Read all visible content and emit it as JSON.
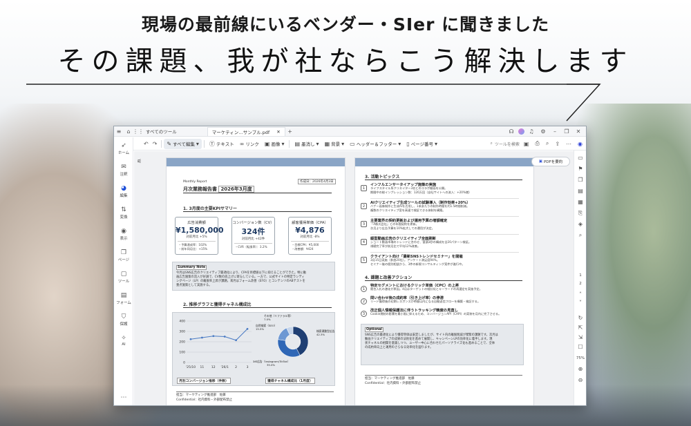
{
  "headline": {
    "top": "現場の最前線にいるベンダー・SIer に聞きました",
    "main": "その課題、我が社ならこう解決します"
  },
  "app": {
    "titlebar": {
      "all_tools": "すべてのツール",
      "doc_tab": "マーケティン…サンプル.pdf"
    },
    "toolbar": {
      "edit_all": "すべて編集",
      "text": "テキスト",
      "link": "リンク",
      "image": "画像",
      "redact": "墨消し",
      "convert": "背景",
      "header_footer": "ヘッダー＆フッター",
      "page_number": "ページ番号",
      "search_placeholder": "ツールを検索"
    },
    "left_nav": [
      "ホーム",
      "注釈",
      "編集",
      "変換",
      "表示",
      "ページ",
      "ツール",
      "フォーム",
      "保護",
      "AI"
    ],
    "summarize_button": "PDFを要約",
    "right_nav": {
      "page_current": "1",
      "page_next": "2",
      "zoom": "75%"
    }
  },
  "page1": {
    "label_monthly": "Monthly Report",
    "created": "作成日：2026年4月3日",
    "title": "月次業務報告書",
    "period": "2026年3月度",
    "section1": "1. 3月度の主要KPIサマリー",
    "kpis": [
      {
        "title": "広告消費額",
        "value": "¥1,580,000",
        "sub": "対前月比 +5%",
        "note1": "・予算達成率：102%",
        "note2": "・前年同月比：+15%"
      },
      {
        "title": "コンバージョン数（CV）",
        "value": "324件",
        "sub": "対前月比 +42件",
        "note1": "・CVR（転換率）：3.2%",
        "note2": ""
      },
      {
        "title": "顧客獲得単価（CPA）",
        "value": "¥4,876",
        "sub": "対前月比 -8%",
        "note1": "・目標CPA：¥5,000",
        "note2": "・改善額：¥424"
      }
    ],
    "summary_title": "Summary Note",
    "summary_text": [
      "今月はSNS広告のクリエイティブ最適化により、CPAを目標値以下に抑えることができた。特に動",
      "画広告施策の流入が好調で、CV数の底上げに寄与している。一方で、公式サイトの特定ランディ",
      "ングページ（LP）の離脱率上昇が課題。来月はフォーム改善（EFO）とコンテンツのABテストを",
      "重点施策として実施する。"
    ],
    "section2": "2. 推移グラフと獲得チャネル構成比",
    "line_caption": "月別コンバージョン推移（件数）",
    "pie_caption": "獲得チャネル構成比（1月度）",
    "footer1": "担当：マーケティング推進部　佐藤",
    "footer2": "Confidential：社内資料・外部配布禁止"
  },
  "chart_data": [
    {
      "type": "line",
      "title": "月別コンバージョン推移（件数）",
      "categories": [
        "'25/10",
        "11",
        "12",
        "'26/1",
        "2",
        "3"
      ],
      "values": [
        225,
        240,
        255,
        250,
        215,
        324
      ],
      "ylim": [
        0,
        400
      ],
      "yticks": [
        0,
        100,
        200,
        300,
        400
      ],
      "grid": true
    },
    {
      "type": "pie",
      "title": "獲得チャネル構成比（1月度）",
      "labels": [
        "検索連動型広告（リスティング）",
        "SNS広告（Instagram/TikTok）",
        "自然検索（SEO）",
        "その他（リファラル等）"
      ],
      "values": [
        42.3,
        35.0,
        15.5,
        7.0
      ],
      "data_labels": [
        "42.3%",
        "35.0%",
        "15.5%",
        "7.0%"
      ],
      "colors": [
        "#1f3f73",
        "#2f67b6",
        "#6d98d3",
        "#c6d5ea"
      ]
    }
  ],
  "page2": {
    "section3": "3. 活動トピックス",
    "topics": [
      {
        "num": "1",
        "title": "インフルエンサータイアップ施策の実施",
        "desc1": "ライフスタイル系クリエイター3名とのコラボ動画を公開。",
        "desc2": "期間中の総インプレッション数：120万回（自社サイトへの流入：+20%増）"
      },
      {
        "num": "2",
        "title": "AIクリエイティブ生成ツールの試験導入（制作効率+20%）",
        "desc1": "バナー画像制作に生成AIを活用し、1本あたりの制作時間を约1.5時間削減。",
        "desc2": "複数のクリエイティブ案を高速で検証できる体制を構築。"
      },
      {
        "num": "3",
        "title": "主要業界の契約更新および運用予算の増額確定",
        "desc1": "「A株式会社」との年間契約を更新。",
        "desc2": "次月より広告予算を10%拡大しての運用が決定。"
      },
      {
        "num": "4",
        "title": "縦型動画広告のクリエイティブ全面刷新",
        "desc1": "ショート動画市場のトレンドに合わせ、冒頭3秒の構成を全20パターン検証。",
        "desc2": "視聴完了率が前月比で平均12%改善。"
      },
      {
        "num": "5",
        "title": "クライアント向け「最新SNSトレンドセミナー」を開催",
        "desc1": "3月15日実施（参加20社）。アンケート満足度94%。",
        "desc2": "セミナー後の個別相談から、3件の新規コンサルティング案件が進行中。"
      }
    ],
    "section4": "4. 課題と改善アクション",
    "actions": [
      {
        "num": "1",
        "title": "特定セグメントにおけるクリック単価（CPC）の上昇",
        "desc": "競合入札の激化が原因。4月はターゲットの細分化とキーワードの再選定を実施予定。"
      },
      {
        "num": "2",
        "title": "問い合わせ後の成約率（引き上げ率）の停滞",
        "desc": "リード獲得後の初期レスポンスが時間以内になる自動返信フローを構築・検証する。"
      },
      {
        "num": "3",
        "title": "改正個人情報保護法に伴うトラッキング精度の見直し",
        "desc": "Cookie規制の影響を最小限に抑えるため、コンバージョンAPI（CAPI）の実装を月内に完了させる。"
      }
    ],
    "optional_title": "Optional",
    "optional_text": [
      "SNS広告の最適化により獲得単価は安定しましたが、サイト内の離脱削減が喫緊の課題です。次月は",
      "動画クリエイティブの成果の法則化を進めて展開し、キャンペーンLPの効率化に着手します。現",
      "状チャネルの相関を意識しつつ、ユーザー中心に合わせたパーソナライズ化も進めることで、全体",
      "の成約率向上と運用のさらなる効率化を図ります。"
    ],
    "footer1": "担当：マーケティング推進部　佐藤",
    "footer2": "Confidential：社内資料・外部配布禁止"
  }
}
